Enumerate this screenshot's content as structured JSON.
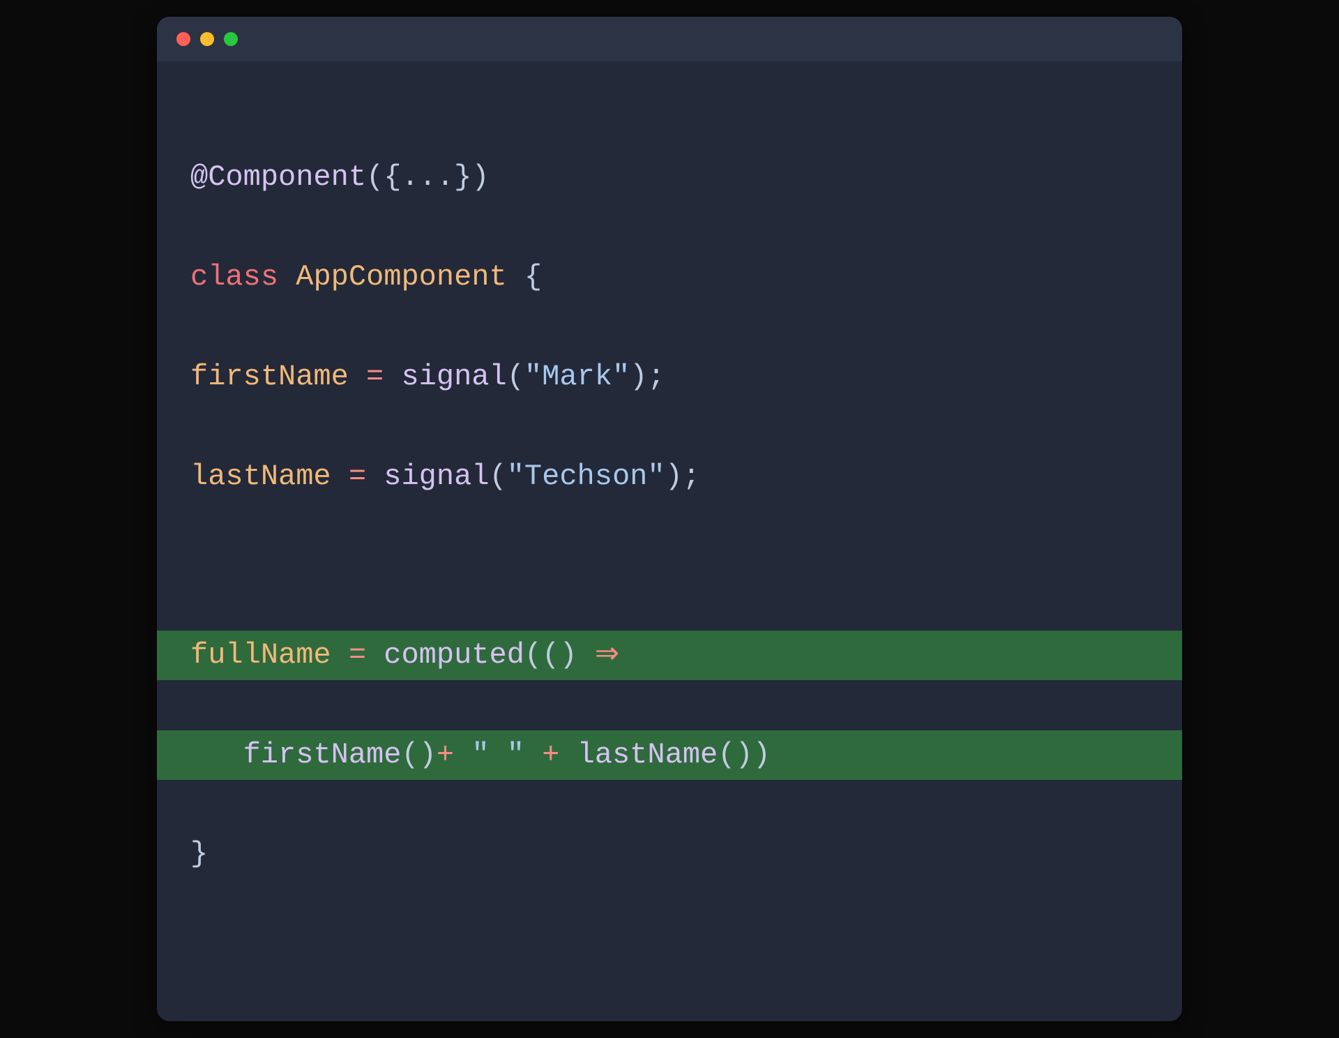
{
  "colors": {
    "background": "#232938",
    "titlebar": "#2c3344",
    "highlight": "#2f6a3d",
    "red": "#ff5f57",
    "yellow": "#febc2e",
    "green": "#28c840",
    "decorator": "#d6c3f2",
    "keyword": "#f07178",
    "className": "#f0b97a",
    "property": "#f0b97a",
    "operator": "#f98d85",
    "func": "#d6c3f2",
    "string": "#a8c8ed",
    "punctuation": "#c2cce1"
  },
  "code": {
    "l1": {
      "decor": "@Component",
      "open": "({",
      "dots": "...",
      "close": "})"
    },
    "l2": {
      "kw": "class",
      "name": "AppComponent",
      "brace": " {"
    },
    "l3": {
      "prop": "firstName",
      "eq": " = ",
      "fn": "signal",
      "open": "(",
      "str": "\"Mark\"",
      "close": ");"
    },
    "l4": {
      "prop": "lastName",
      "eq": " = ",
      "fn": "signal",
      "open": "(",
      "str": "\"Techson\"",
      "close": ");"
    },
    "l6": {
      "prop": "fullName",
      "eq": " = ",
      "fn": "computed",
      "open": "(() ",
      "arrow": "⇒"
    },
    "l7": {
      "pad": "   ",
      "fn1": "firstName",
      "call1": "()",
      "plus1": "+ ",
      "str": "\" \"",
      "plus2": " + ",
      "fn2": "lastName",
      "call2": "())"
    },
    "l8": {
      "brace": "}"
    }
  }
}
